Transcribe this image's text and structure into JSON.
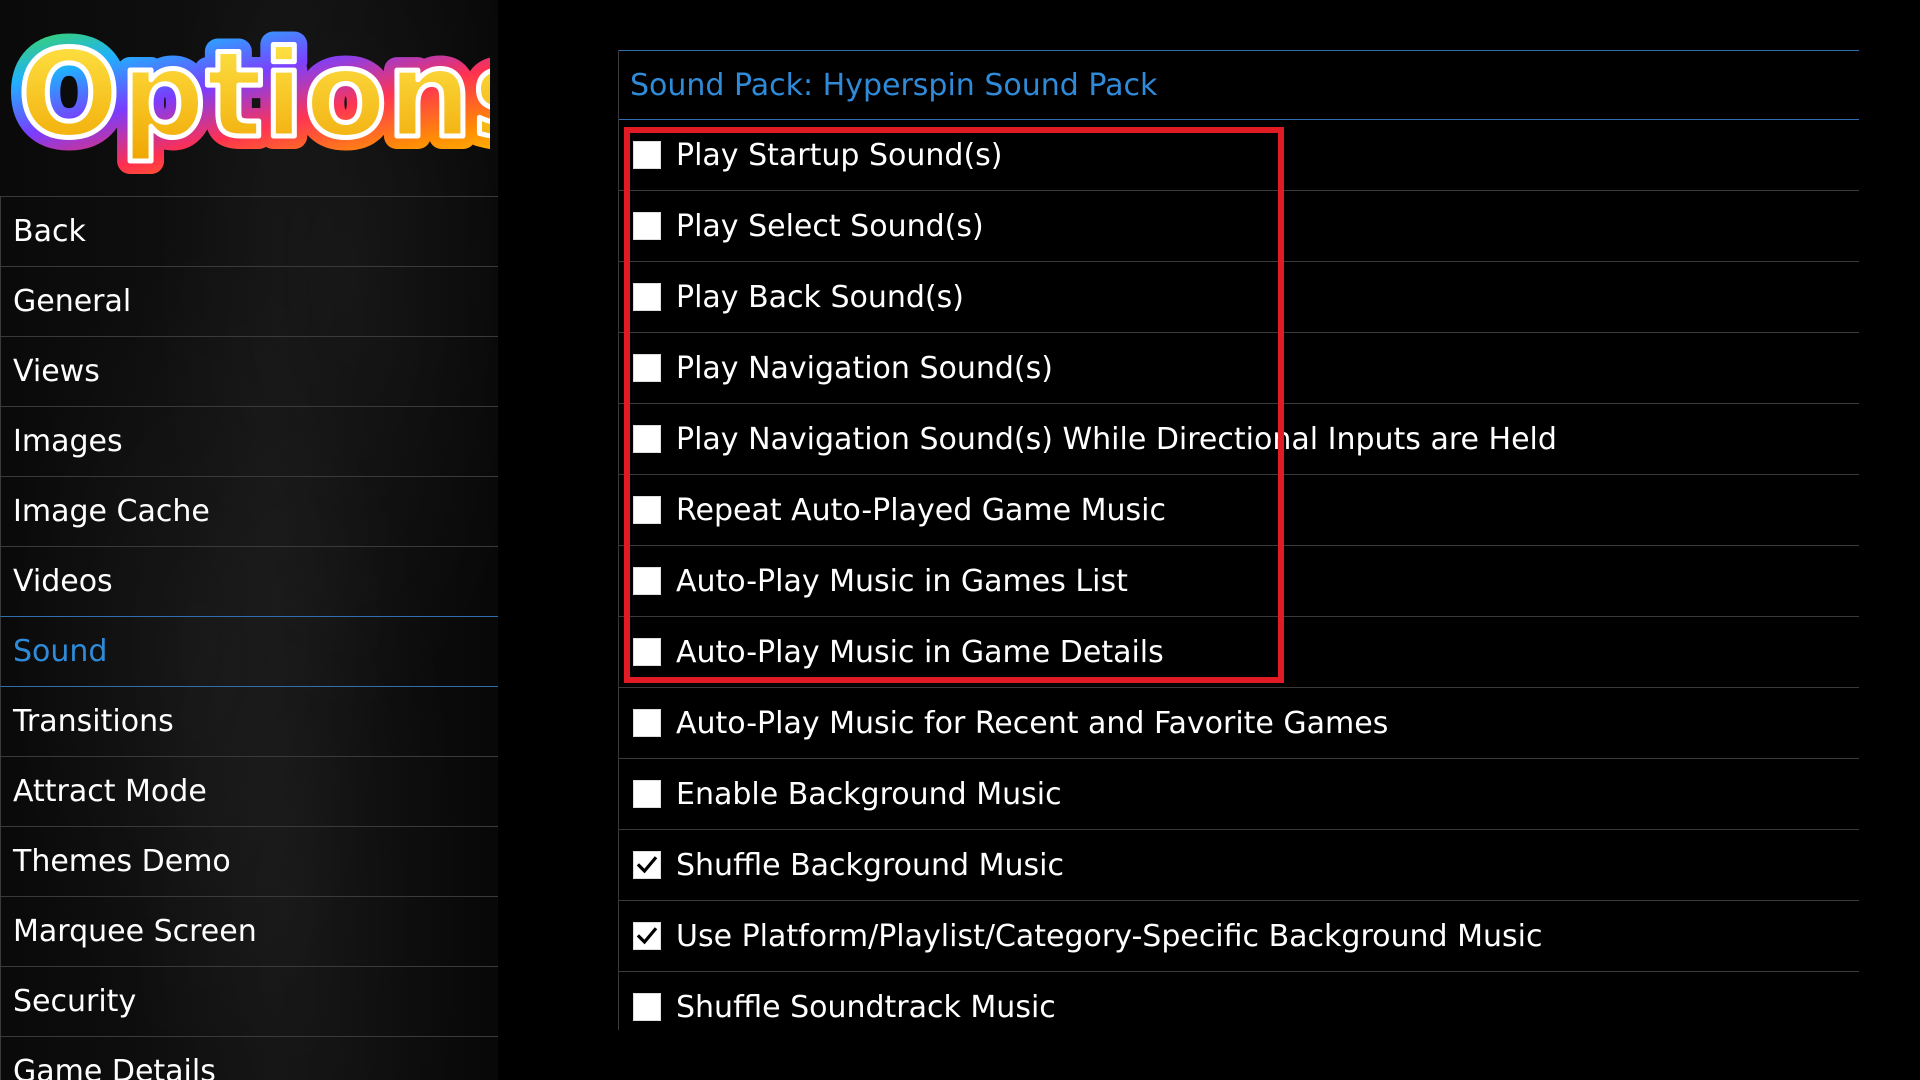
{
  "logo": {
    "text": "Options",
    "gradient_colors": [
      "#ffd200",
      "#ff8a00",
      "#ff2f4f",
      "#7a3cff",
      "#20b0ff",
      "#3ddc4a"
    ]
  },
  "sidebar": {
    "items": [
      {
        "label": "Back",
        "active": false
      },
      {
        "label": "General",
        "active": false
      },
      {
        "label": "Views",
        "active": false
      },
      {
        "label": "Images",
        "active": false
      },
      {
        "label": "Image Cache",
        "active": false
      },
      {
        "label": "Videos",
        "active": false
      },
      {
        "label": "Sound",
        "active": true
      },
      {
        "label": "Transitions",
        "active": false
      },
      {
        "label": "Attract Mode",
        "active": false
      },
      {
        "label": "Themes Demo",
        "active": false
      },
      {
        "label": "Marquee Screen",
        "active": false
      },
      {
        "label": "Security",
        "active": false
      },
      {
        "label": "Game Details",
        "active": false
      }
    ]
  },
  "main": {
    "sound_pack_label": "Sound Pack: Hyperspin Sound Pack",
    "options": [
      {
        "label": "Play Startup Sound(s)",
        "checked": false
      },
      {
        "label": "Play Select Sound(s)",
        "checked": false
      },
      {
        "label": "Play Back Sound(s)",
        "checked": false
      },
      {
        "label": "Play Navigation Sound(s)",
        "checked": false
      },
      {
        "label": "Play Navigation Sound(s) While Directional Inputs are Held",
        "checked": false
      },
      {
        "label": "Repeat Auto-Played Game Music",
        "checked": false
      },
      {
        "label": "Auto-Play Music in Games List",
        "checked": false
      },
      {
        "label": "Auto-Play Music in Game Details",
        "checked": false
      },
      {
        "label": "Auto-Play Music for Recent and Favorite Games",
        "checked": false
      },
      {
        "label": "Enable Background Music",
        "checked": false
      },
      {
        "label": "Shuffle Background Music",
        "checked": true
      },
      {
        "label": "Use Platform/Playlist/Category-Specific Background Music",
        "checked": true
      },
      {
        "label": "Shuffle Soundtrack Music",
        "checked": false
      }
    ]
  },
  "colors": {
    "accent_blue": "#2f8ad8",
    "highlight_red": "#e01b24",
    "divider": "#3a3a3a"
  }
}
